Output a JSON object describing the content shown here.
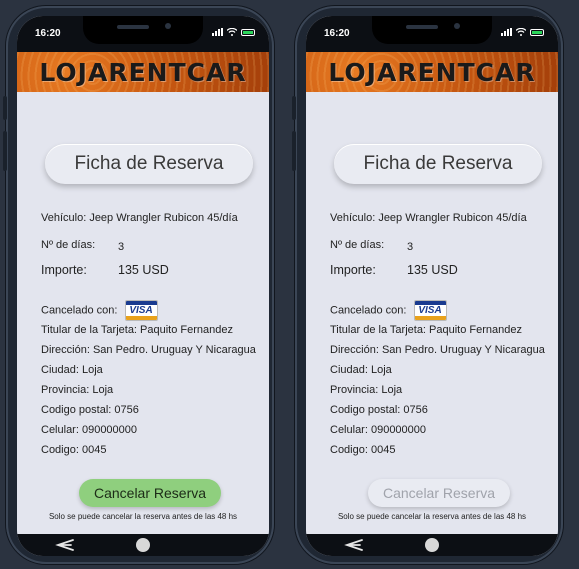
{
  "screens": [
    {
      "status": {
        "time": "16:20"
      },
      "brand": "LOJARENTCAR",
      "title": "Ficha de Reserva",
      "vehicle": "Vehículo: Jeep Wrangler Rubicon 45/día",
      "days_label": "Nº de días:",
      "days_value": "3",
      "amount_label": "Importe:",
      "amount_value": "135  USD",
      "paid_with_label": "Cancelado con:",
      "card_brand": "VISA",
      "holder": "Titular de la Tarjeta: Paquito Fernandez",
      "address": "Dirección: San Pedro. Uruguay Y Nicaragua",
      "city": "Ciudad: Loja",
      "province": "Provincia: Loja",
      "postal": "Codigo postal:  0756",
      "phone": "Celular: 090000000",
      "code": "Codigo: 0045",
      "cancel_button": "Cancelar Reserva",
      "cancel_note": "Solo se puede cancelar la reserva antes de las 48 hs",
      "button_state": "enabled"
    },
    {
      "status": {
        "time": "16:20"
      },
      "brand": "LOJARENTCAR",
      "title": "Ficha de Reserva",
      "vehicle": "Vehículo: Jeep Wrangler Rubicon 45/día",
      "days_label": "Nº de días:",
      "days_value": "3",
      "amount_label": "Importe:",
      "amount_value": "135  USD",
      "paid_with_label": "Cancelado con:",
      "card_brand": "VISA",
      "holder": "Titular de la Tarjeta: Paquito Fernandez",
      "address": "Dirección: San Pedro. Uruguay Y Nicaragua",
      "city": "Ciudad: Loja",
      "province": "Provincia: Loja",
      "postal": "Codigo postal:  0756",
      "phone": "Celular: 090000000",
      "code": "Codigo: 0045",
      "cancel_button": "Cancelar Reserva",
      "cancel_note": "Solo se puede cancelar la reserva antes de las 48 hs",
      "button_state": "disabled"
    }
  ],
  "colors": {
    "button_enabled": "#8fcf7e",
    "button_disabled": "#e9ebf2",
    "banner": "#c95a12",
    "screen_bg": "#e3e5ee"
  },
  "icons": [
    "back-arrow-icon",
    "home-button-icon",
    "signal-icon",
    "wifi-icon",
    "battery-icon",
    "visa-card-icon"
  ]
}
